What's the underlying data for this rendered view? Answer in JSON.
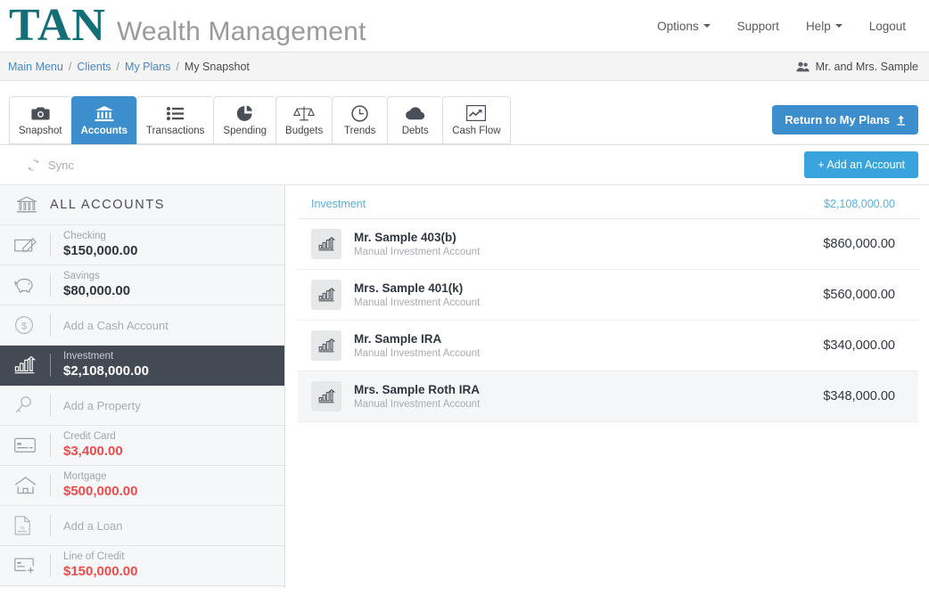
{
  "brand": {
    "mark": "TAN",
    "rest": "Wealth Management"
  },
  "topnav": [
    {
      "label": "Options",
      "caret": true
    },
    {
      "label": "Support",
      "caret": false
    },
    {
      "label": "Help",
      "caret": true
    },
    {
      "label": "Logout",
      "caret": false
    }
  ],
  "breadcrumb": {
    "items": [
      "Main Menu",
      "Clients",
      "My Plans"
    ],
    "current": "My Snapshot",
    "separator": "/",
    "client": "Mr. and Mrs. Sample"
  },
  "tabs": [
    {
      "label": "Snapshot",
      "icon": "camera-icon",
      "active": false
    },
    {
      "label": "Accounts",
      "icon": "bank-icon",
      "active": true
    },
    {
      "label": "Transactions",
      "icon": "list-icon",
      "active": false
    },
    {
      "label": "Spending",
      "icon": "pie-chart-icon",
      "active": false
    },
    {
      "label": "Budgets",
      "icon": "scales-icon",
      "active": false
    },
    {
      "label": "Trends",
      "icon": "clock-icon",
      "active": false
    },
    {
      "label": "Debts",
      "icon": "cloud-icon",
      "active": false
    },
    {
      "label": "Cash Flow",
      "icon": "line-chart-icon",
      "active": false
    }
  ],
  "actions": {
    "return_label": "Return to My Plans",
    "sync_label": "Sync",
    "add_account_label": "+ Add an Account"
  },
  "sidebar": {
    "header": "ALL ACCOUNTS",
    "items": [
      {
        "name": "Checking",
        "amount": "$150,000.00",
        "icon": "check-icon",
        "negative": false,
        "selected": false,
        "placeholder": null
      },
      {
        "name": "Savings",
        "amount": "$80,000.00",
        "icon": "piggy-bank-icon",
        "negative": false,
        "selected": false,
        "placeholder": null
      },
      {
        "name": null,
        "amount": null,
        "icon": "dollar-coin-icon",
        "negative": false,
        "selected": false,
        "placeholder": "Add a Cash Account"
      },
      {
        "name": "Investment",
        "amount": "$2,108,000.00",
        "icon": "bar-chart-icon",
        "negative": false,
        "selected": true,
        "placeholder": null
      },
      {
        "name": null,
        "amount": null,
        "icon": "key-icon",
        "negative": false,
        "selected": false,
        "placeholder": "Add a Property"
      },
      {
        "name": "Credit Card",
        "amount": "$3,400.00",
        "icon": "credit-card-icon",
        "negative": true,
        "selected": false,
        "placeholder": null
      },
      {
        "name": "Mortgage",
        "amount": "$500,000.00",
        "icon": "house-icon",
        "negative": true,
        "selected": false,
        "placeholder": null
      },
      {
        "name": null,
        "amount": null,
        "icon": "document-icon",
        "negative": false,
        "selected": false,
        "placeholder": "Add a Loan"
      },
      {
        "name": "Line of Credit",
        "amount": "$150,000.00",
        "icon": "card-plus-icon",
        "negative": true,
        "selected": false,
        "placeholder": null
      }
    ]
  },
  "main": {
    "group_name": "Investment",
    "group_total": "$2,108,000.00",
    "accounts": [
      {
        "name": "Mr. Sample 403(b)",
        "subtitle": "Manual Investment Account",
        "amount": "$860,000.00",
        "highlighted": false
      },
      {
        "name": "Mrs. Sample 401(k)",
        "subtitle": "Manual Investment Account",
        "amount": "$560,000.00",
        "highlighted": false
      },
      {
        "name": "Mr. Sample IRA",
        "subtitle": "Manual Investment Account",
        "amount": "$340,000.00",
        "highlighted": false
      },
      {
        "name": "Mrs. Sample Roth IRA",
        "subtitle": "Manual Investment Account",
        "amount": "$348,000.00",
        "highlighted": true
      }
    ]
  },
  "colors": {
    "brand_teal": "#136E78",
    "tab_active_blue": "#3d8ecc",
    "add_button_blue": "#38a3dc",
    "link_blue": "#4a86c8",
    "group_blue": "#57b0e0",
    "negative_red": "#ed4b4b",
    "selected_slate": "#434a54"
  }
}
